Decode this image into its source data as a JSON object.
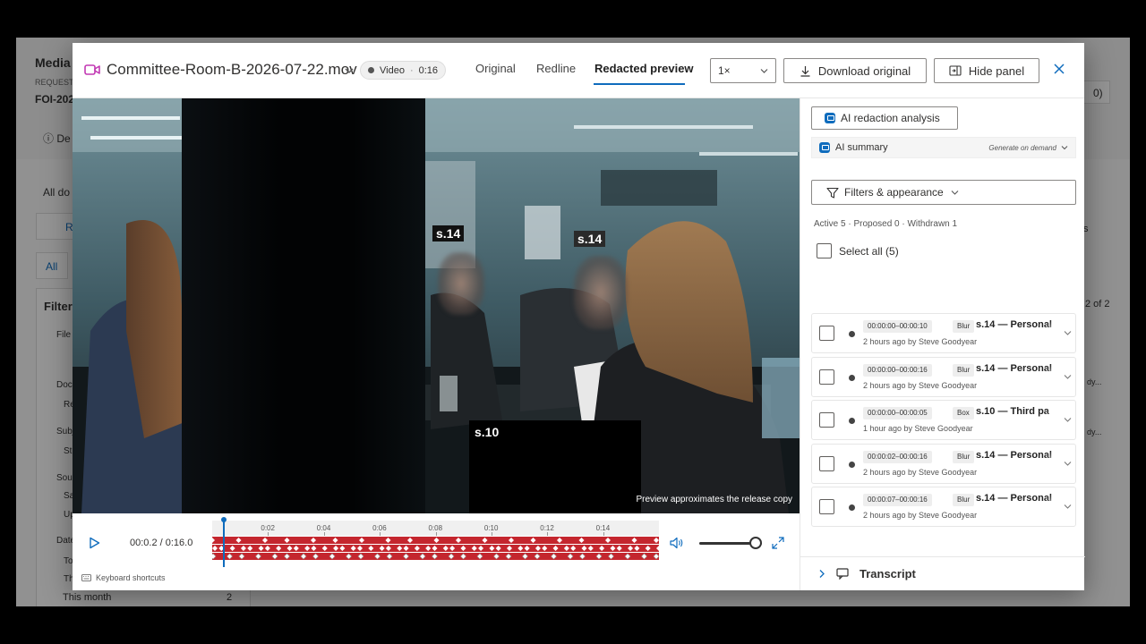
{
  "background": {
    "title": "Media",
    "request_label": "REQUEST",
    "request_id": "FOI-202",
    "tab_details": "De",
    "all_documents": "All do",
    "btn_r": "R",
    "all_chip": "All",
    "filters": "Filter",
    "file_label": "File",
    "doc_label": "Doc",
    "doc_opt": "Re",
    "subject_label": "Subj",
    "subject_opt": "Ste",
    "source_label": "Sou",
    "source_opt1": "Sa",
    "source_opt2": "Up",
    "date_label": "Date",
    "date_opt1": "To",
    "date_opt2": "Th",
    "date_opt3": "This month",
    "date_count3": "2",
    "right_count": "0)",
    "right_s": "s",
    "page_of": "2 of 2",
    "right_dy1": "dy...",
    "right_dy2": "dy..."
  },
  "header": {
    "filename": "Committee-Room-B-2026-07-22.mov",
    "badge_type": "Video",
    "badge_duration": "0:16",
    "tabs": [
      {
        "label": "Original"
      },
      {
        "label": "Redline"
      },
      {
        "label": "Redacted preview"
      }
    ],
    "speed": "1×",
    "download_label": "Download original",
    "hide_panel_label": "Hide panel",
    "accent": "#0f6cbd",
    "file_icon_color": "#c239b3"
  },
  "video": {
    "labels": [
      "s.14",
      "s.14",
      "s.10"
    ],
    "preview_note": "Preview approximates the release copy"
  },
  "controls": {
    "time": "00:0.2 / 0:16.0",
    "progress": 0.0125,
    "tick_labels": [
      "0:02",
      "0:04",
      "0:06",
      "0:08",
      "0:10",
      "0:12",
      "0:14"
    ],
    "track_color": "#c4262e",
    "volume": 1.0,
    "keyboard_shortcuts": "Keyboard shortcuts"
  },
  "side": {
    "ai_analysis": "AI redaction analysis",
    "ai_summary": "AI summary",
    "ai_summary_action": "Generate on demand",
    "filters": "Filters & appearance",
    "counts": "Active 5 · Proposed 0 · Withdrawn 1",
    "select_all": "Select all (5)",
    "items": [
      {
        "time": "00:00:00–00:00:10",
        "type": "Blur",
        "title": "s.14 — Personal",
        "meta": "2 hours ago by Steve Goodyear"
      },
      {
        "time": "00:00:00–00:00:16",
        "type": "Blur",
        "title": "s.14 — Personal",
        "meta": "2 hours ago by Steve Goodyear"
      },
      {
        "time": "00:00:00–00:00:05",
        "type": "Box",
        "title": "s.10 — Third pa",
        "meta": "1 hour ago by Steve Goodyear"
      },
      {
        "time": "00:00:02–00:00:16",
        "type": "Blur",
        "title": "s.14 — Personal",
        "meta": "2 hours ago by Steve Goodyear"
      },
      {
        "time": "00:00:07–00:00:16",
        "type": "Blur",
        "title": "s.14 — Personal",
        "meta": "2 hours ago by Steve Goodyear"
      }
    ],
    "transcript": "Transcript"
  }
}
